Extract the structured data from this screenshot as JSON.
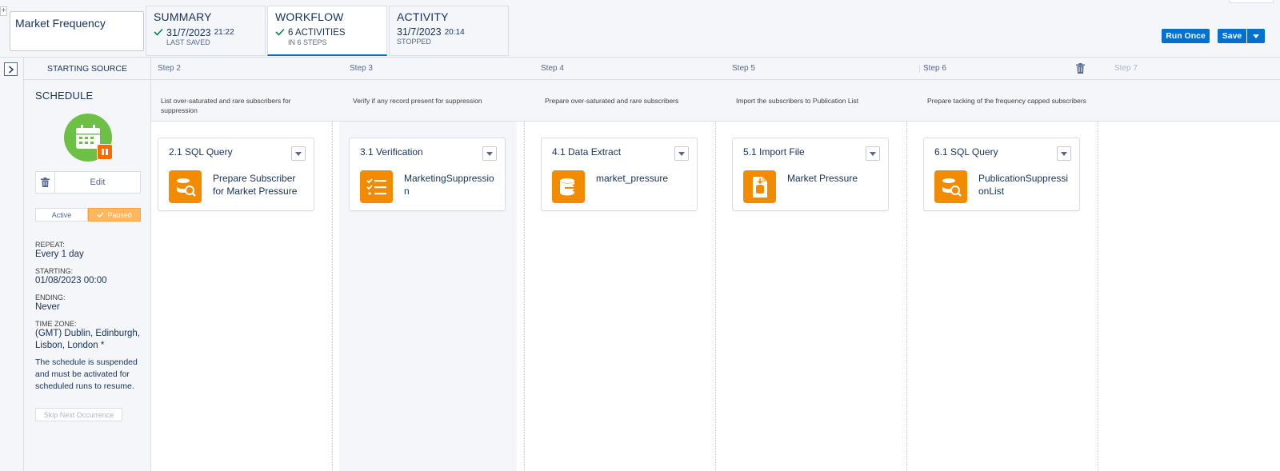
{
  "header": {
    "name_value": "Market Frequency",
    "tabs": [
      {
        "title": "SUMMARY",
        "date": "31/7/2023",
        "time": "21:22",
        "sub": "LAST SAVED",
        "check": true
      },
      {
        "title": "WORKFLOW",
        "date": "6 ACTIVITIES",
        "time": "",
        "sub": "IN 6 STEPS",
        "check": true
      },
      {
        "title": "ACTIVITY",
        "date": "31/7/2023",
        "time": "20:14",
        "sub": "STOPPED",
        "check": false
      }
    ],
    "run_once_label": "Run Once",
    "save_label": "Save",
    "plus_glyph": "+"
  },
  "source": {
    "header": "STARTING SOURCE",
    "title": "SCHEDULE",
    "edit_label": "Edit",
    "active_label": "Active",
    "paused_label": "Paused",
    "repeat_label": "REPEAT:",
    "repeat_value": "Every 1 day",
    "starting_label": "STARTING:",
    "starting_value": "01/08/2023 00:00",
    "ending_label": "ENDING:",
    "ending_value": "Never",
    "tz_label": "TIME ZONE:",
    "tz_value": "(GMT) Dublin, Edinburgh, Lisbon, London *",
    "note": "The schedule is suspended and must be activated for scheduled runs to resume.",
    "skip_label": "Skip Next Occurrence"
  },
  "steps": [
    {
      "label": "Step 2",
      "desc": "List over-saturated and rare subscribers for suppression",
      "card_title": "2.1 SQL Query",
      "card_name": "Prepare Subscriber for Market Pressure",
      "icon": "sql-query-icon"
    },
    {
      "label": "Step 3",
      "desc": "Verify if any record present for suppression",
      "card_title": "3.1 Verification",
      "card_name": "MarketingSuppression",
      "icon": "verification-icon"
    },
    {
      "label": "Step 4",
      "desc": "Prepare over-saturated and rare subscribers",
      "card_title": "4.1 Data Extract",
      "card_name": "market_pressure",
      "icon": "data-extract-icon"
    },
    {
      "label": "Step 5",
      "desc": "Import the subscribers to Publication List",
      "card_title": "5.1 Import File",
      "card_name": "Market Pressure",
      "icon": "import-file-icon"
    },
    {
      "label": "Step 6",
      "desc": "Prepare tacking of the frequency capped subscribers",
      "card_title": "6.1 SQL Query",
      "card_name": "PublicationSuppressionList",
      "icon": "sql-query-icon"
    },
    {
      "label": "Step 7",
      "desc": "",
      "card_title": "",
      "card_name": "",
      "icon": ""
    }
  ],
  "colors": {
    "accent": "#0070d2",
    "activity_orange": "#f28b00",
    "schedule_green": "#6cc046",
    "paused_orange": "#ffb75d",
    "check_green": "#04844b"
  }
}
